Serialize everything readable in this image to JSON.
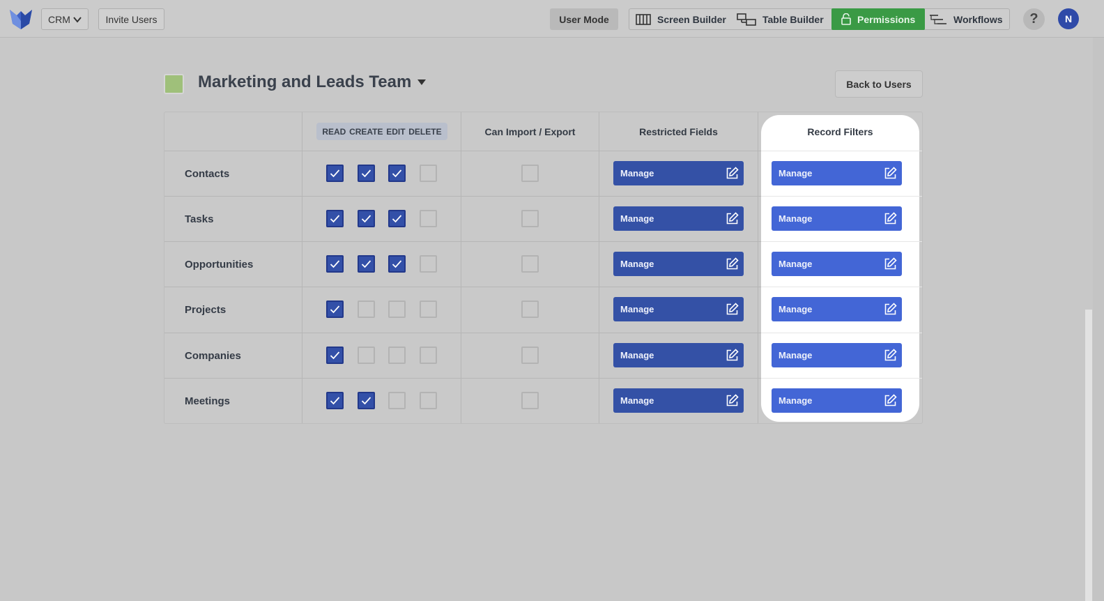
{
  "topbar": {
    "app_select": "CRM",
    "invite_label": "Invite Users",
    "user_mode_label": "User Mode",
    "builders": {
      "screen_builder": "Screen Builder",
      "table_builder": "Table Builder",
      "permissions": "Permissions",
      "workflows": "Workflows"
    },
    "help": "?",
    "avatar_initial": "N"
  },
  "team": {
    "name": "Marketing and Leads Team",
    "color": "#9fc07a",
    "back_label": "Back to Users"
  },
  "table": {
    "perm_headers": [
      "READ",
      "CREATE",
      "EDIT",
      "DELETE"
    ],
    "import_export_header": "Can Import / Export",
    "restricted_header": "Restricted Fields",
    "record_filters_header": "Record Filters",
    "manage_label": "Manage",
    "rows": [
      {
        "label": "Contacts",
        "read": true,
        "create": true,
        "edit": true,
        "delete": false,
        "import_export": false
      },
      {
        "label": "Tasks",
        "read": true,
        "create": true,
        "edit": true,
        "delete": false,
        "import_export": false
      },
      {
        "label": "Opportunities",
        "read": true,
        "create": true,
        "edit": true,
        "delete": false,
        "import_export": false
      },
      {
        "label": "Projects",
        "read": true,
        "create": false,
        "edit": false,
        "delete": false,
        "import_export": false
      },
      {
        "label": "Companies",
        "read": true,
        "create": false,
        "edit": false,
        "delete": false,
        "import_export": false
      },
      {
        "label": "Meetings",
        "read": true,
        "create": true,
        "edit": false,
        "delete": false,
        "import_export": false
      }
    ]
  },
  "colors": {
    "active_green": "#3a9a45",
    "checkbox_blue": "#3350a8",
    "manage_dark": "#3451a6",
    "manage_bright": "#4366d6"
  }
}
